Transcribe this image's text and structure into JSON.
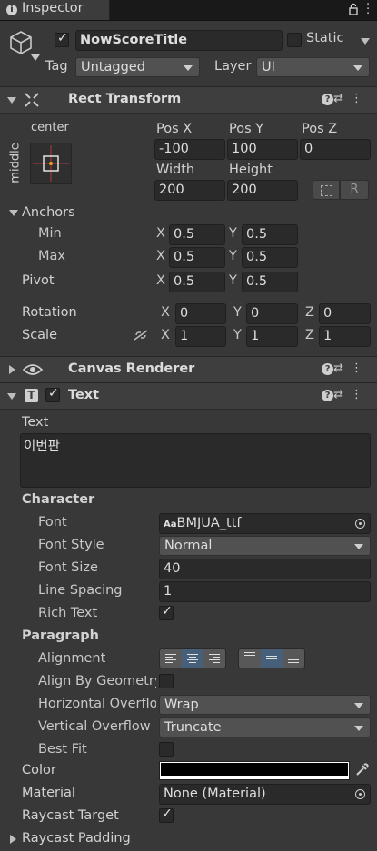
{
  "tab": {
    "title": "Inspector"
  },
  "gameobject": {
    "active": true,
    "name": "NowScoreTitle",
    "static_label": "Static",
    "tag_label": "Tag",
    "tag_value": "Untagged",
    "layer_label": "Layer",
    "layer_value": "UI"
  },
  "rect_transform": {
    "title": "Rect Transform",
    "anchor_preset_top": "center",
    "anchor_preset_side": "middle",
    "pos_x_label": "Pos X",
    "pos_y_label": "Pos Y",
    "pos_z_label": "Pos Z",
    "pos_x": "-100",
    "pos_y": "100",
    "pos_z": "0",
    "width_label": "Width",
    "height_label": "Height",
    "width": "200",
    "height": "200",
    "raw_edit_label": "R",
    "anchors_label": "Anchors",
    "min_label": "Min",
    "max_label": "Max",
    "min_x": "0.5",
    "min_y": "0.5",
    "max_x": "0.5",
    "max_y": "0.5",
    "pivot_label": "Pivot",
    "pivot_x": "0.5",
    "pivot_y": "0.5",
    "rotation_label": "Rotation",
    "rot_x": "0",
    "rot_y": "0",
    "rot_z": "0",
    "scale_label": "Scale",
    "scale_x": "1",
    "scale_y": "1",
    "scale_z": "1",
    "axis_x": "X",
    "axis_y": "Y",
    "axis_z": "Z"
  },
  "canvas_renderer": {
    "title": "Canvas Renderer"
  },
  "text_component": {
    "title": "Text",
    "enabled": true,
    "text_label": "Text",
    "text_value": "이번판",
    "character_label": "Character",
    "font_label": "Font",
    "font_value": "BMJUA_ttf",
    "font_badge": "Aa",
    "font_style_label": "Font Style",
    "font_style_value": "Normal",
    "font_size_label": "Font Size",
    "font_size_value": "40",
    "line_spacing_label": "Line Spacing",
    "line_spacing_value": "1",
    "rich_text_label": "Rich Text",
    "rich_text": true,
    "paragraph_label": "Paragraph",
    "alignment_label": "Alignment",
    "align_by_geometry_label": "Align By Geometry",
    "align_by_geometry": false,
    "h_overflow_label": "Horizontal Overflow",
    "h_overflow_value": "Wrap",
    "v_overflow_label": "Vertical Overflow",
    "v_overflow_value": "Truncate",
    "best_fit_label": "Best Fit",
    "best_fit": false,
    "color_label": "Color",
    "color_value": "#000000",
    "material_label": "Material",
    "material_value": "None (Material)",
    "raycast_target_label": "Raycast Target",
    "raycast_target": true,
    "raycast_padding_label": "Raycast Padding"
  }
}
